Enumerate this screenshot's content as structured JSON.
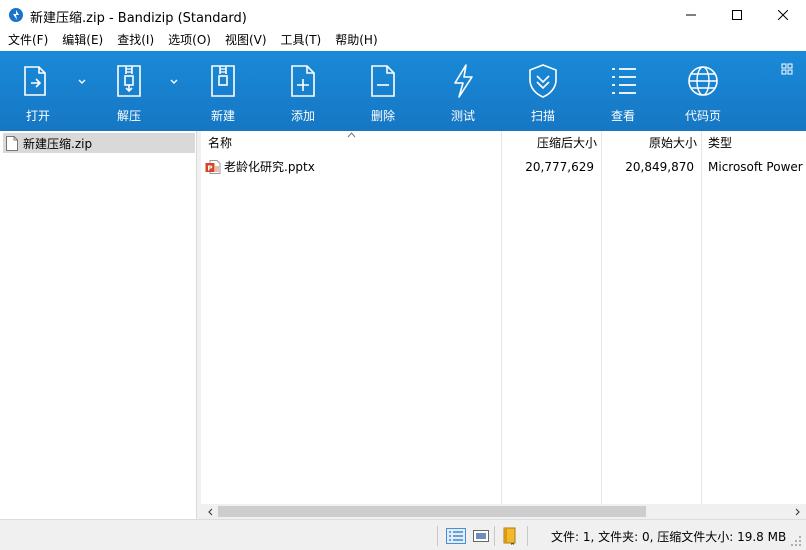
{
  "window": {
    "title": "新建压缩.zip - Bandizip (Standard)"
  },
  "menu": [
    {
      "label": "文件(F)"
    },
    {
      "label": "编辑(E)"
    },
    {
      "label": "查找(I)"
    },
    {
      "label": "选项(O)"
    },
    {
      "label": "视图(V)"
    },
    {
      "label": "工具(T)"
    },
    {
      "label": "帮助(H)"
    }
  ],
  "toolbar": {
    "open": "打开",
    "extract": "解压",
    "new": "新建",
    "add": "添加",
    "delete": "删除",
    "test": "测试",
    "scan": "扫描",
    "view": "查看",
    "codepage": "代码页"
  },
  "tree": {
    "archive_name": "新建压缩.zip"
  },
  "list": {
    "columns": {
      "name": "名称",
      "packed_size": "压缩后大小",
      "original_size": "原始大小",
      "type": "类型"
    },
    "rows": [
      {
        "name": "老龄化研究.pptx",
        "packed_size": "20,777,629",
        "original_size": "20,849,870",
        "type": "Microsoft Power"
      }
    ]
  },
  "status": {
    "text": "文件: 1, 文件夹: 0, 压缩文件大小: 19.8 MB"
  },
  "colors": {
    "toolbar": "#1a86d4",
    "selection": "#d9d9d9",
    "ppt_icon": "#d24726"
  }
}
